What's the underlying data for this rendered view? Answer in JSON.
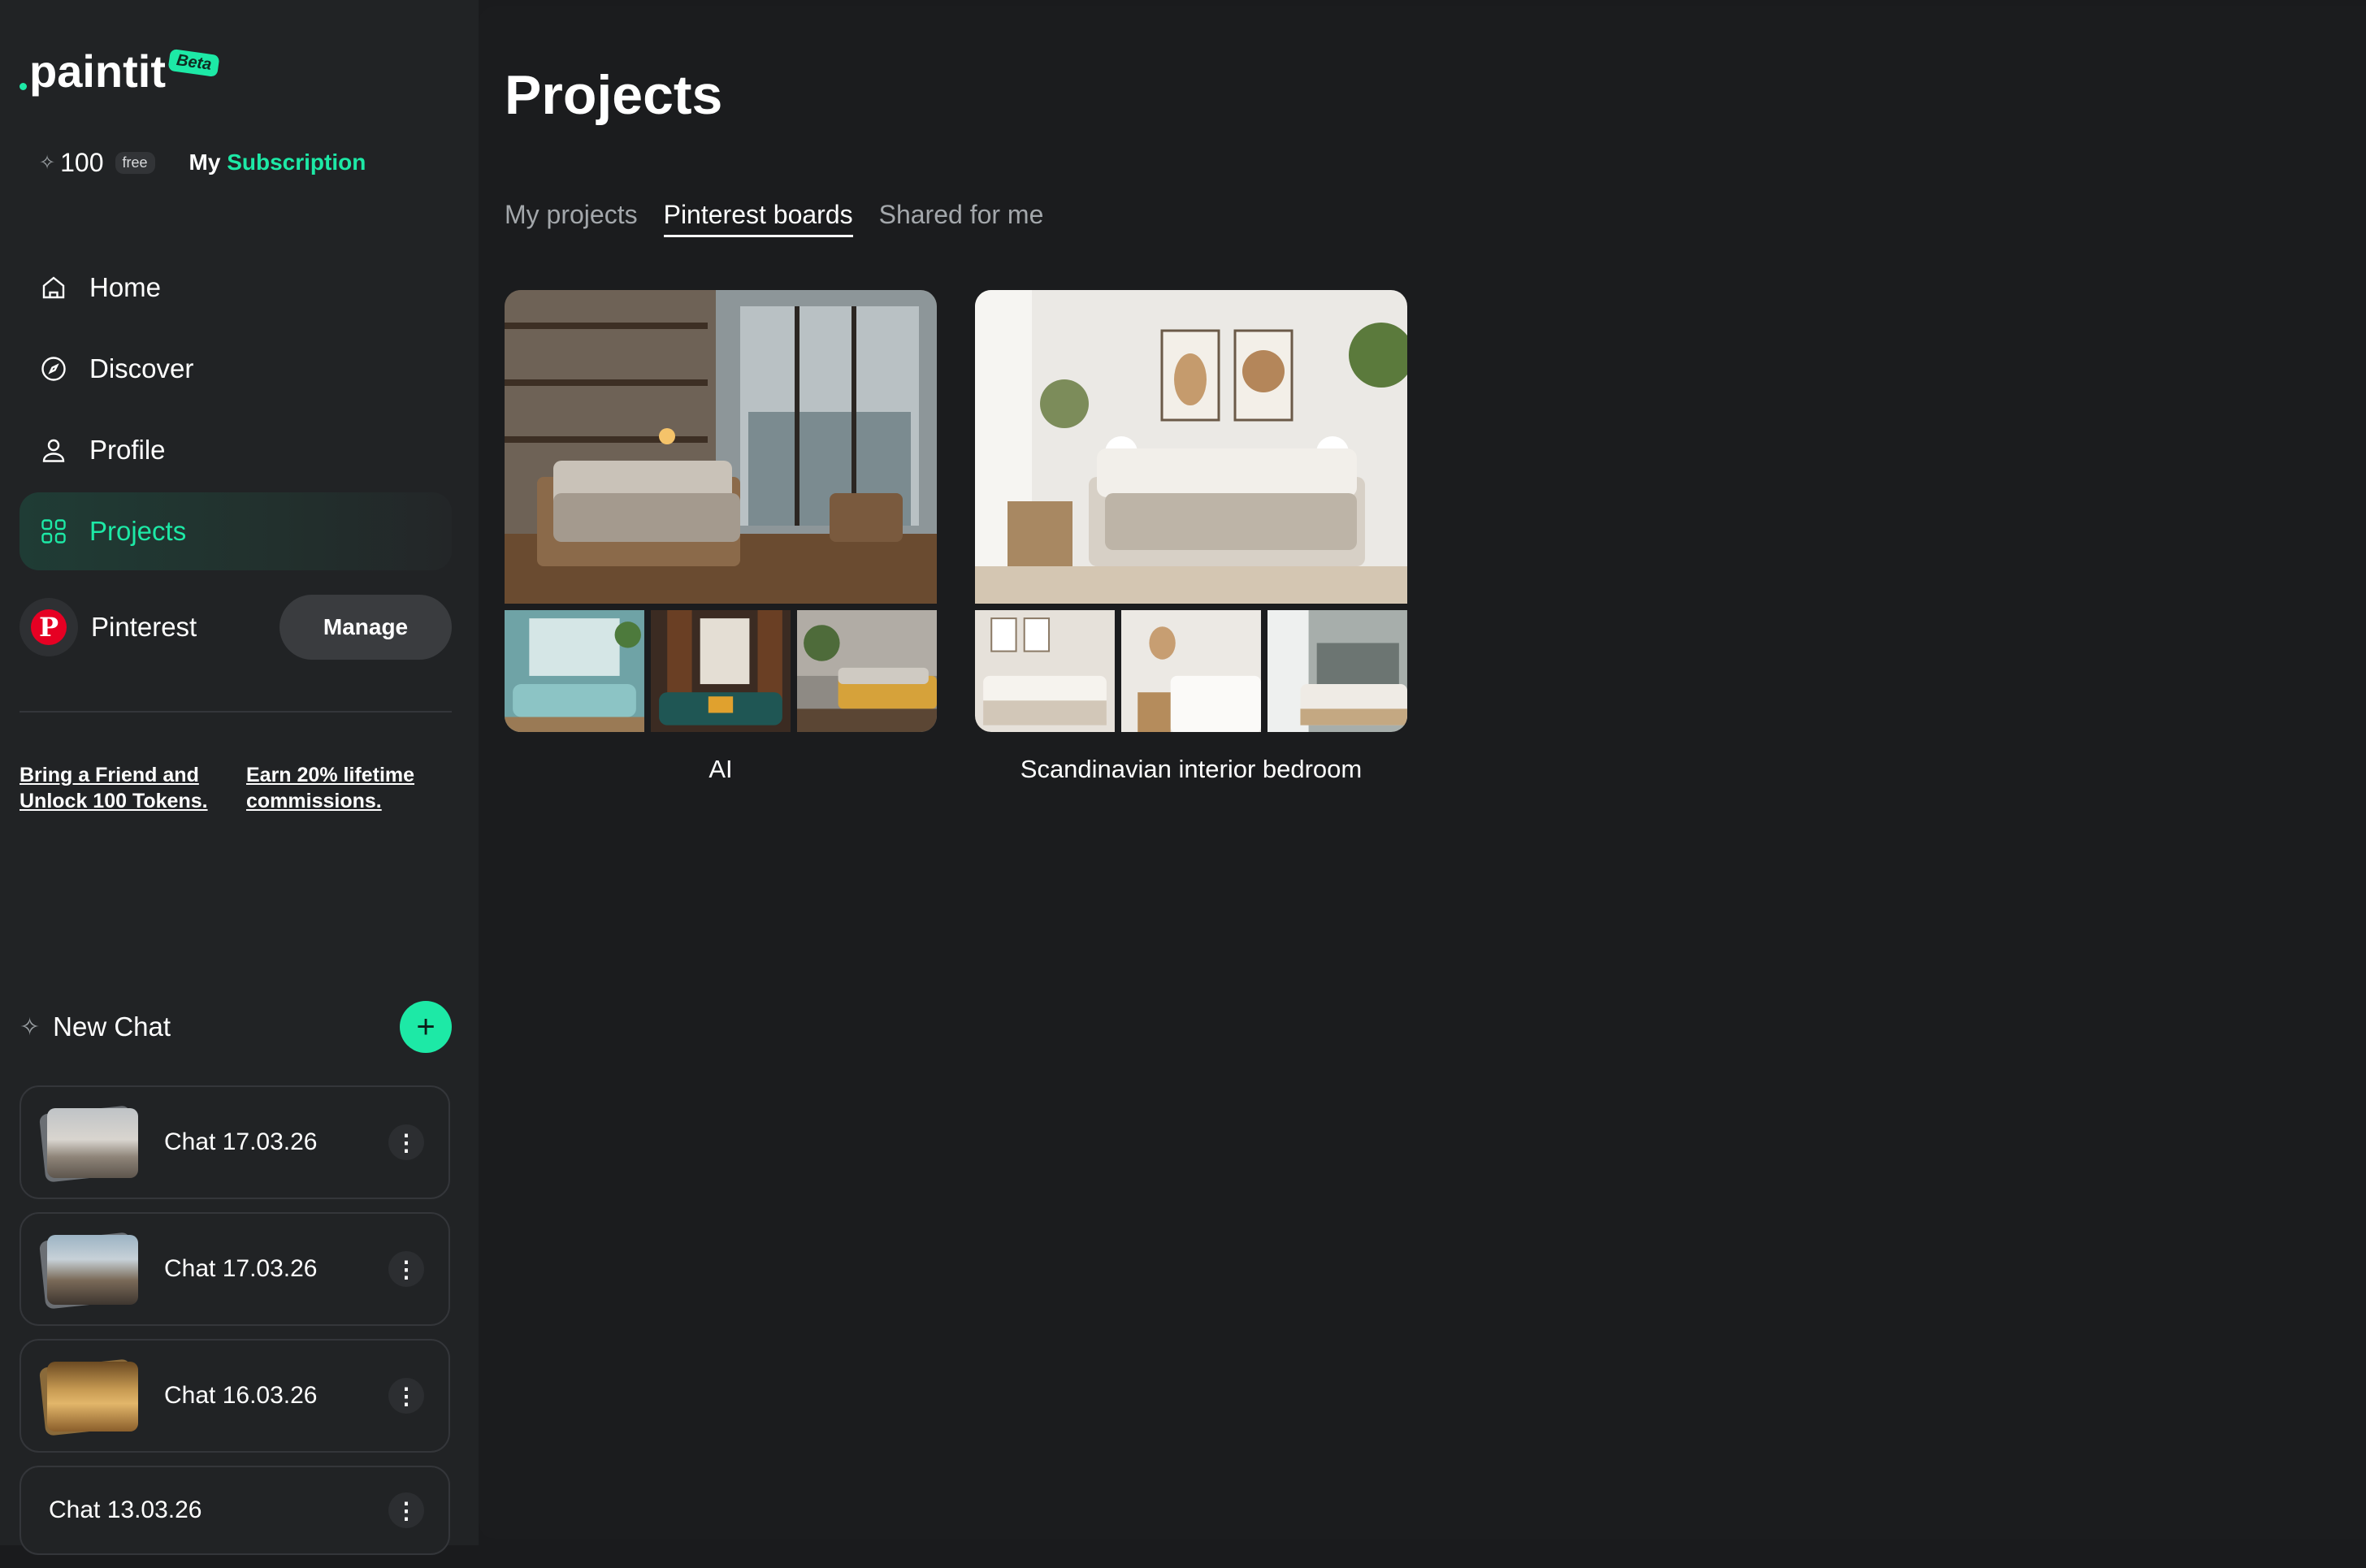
{
  "brand": {
    "name": "paintit",
    "badge": "Beta"
  },
  "tokens": {
    "count": "100",
    "tier": "free",
    "subscription_prefix": "My ",
    "subscription_accent": "Subscription"
  },
  "nav": {
    "items": [
      {
        "label": "Home",
        "icon": "home-icon"
      },
      {
        "label": "Discover",
        "icon": "compass-icon"
      },
      {
        "label": "Profile",
        "icon": "user-icon"
      },
      {
        "label": "Projects",
        "icon": "grid-icon",
        "active": true
      }
    ]
  },
  "pinterest": {
    "label": "Pinterest",
    "manage_label": "Manage"
  },
  "promos": {
    "referral": "Bring a Friend and Unlock 100 Tokens.",
    "affiliate": "Earn 20% lifetime commissions."
  },
  "chats": {
    "new_chat_label": "New Chat",
    "items": [
      {
        "title": "Chat 17.03.26",
        "has_thumb": true
      },
      {
        "title": "Chat 17.03.26",
        "has_thumb": true
      },
      {
        "title": "Chat 16.03.26",
        "has_thumb": true
      },
      {
        "title": "Chat 13.03.26",
        "has_thumb": false
      }
    ]
  },
  "main": {
    "title": "Projects",
    "tabs": [
      {
        "label": "My projects",
        "active": false
      },
      {
        "label": "Pinterest boards",
        "active": true
      },
      {
        "label": "Shared for me",
        "active": false
      }
    ],
    "boards": [
      {
        "name": "AI"
      },
      {
        "name": "Scandinavian interior bedroom"
      }
    ]
  },
  "colors": {
    "accent": "#1de9a6",
    "sidebar_bg": "#212325",
    "main_bg": "#1b1c1e",
    "pinterest_red": "#e60023"
  }
}
